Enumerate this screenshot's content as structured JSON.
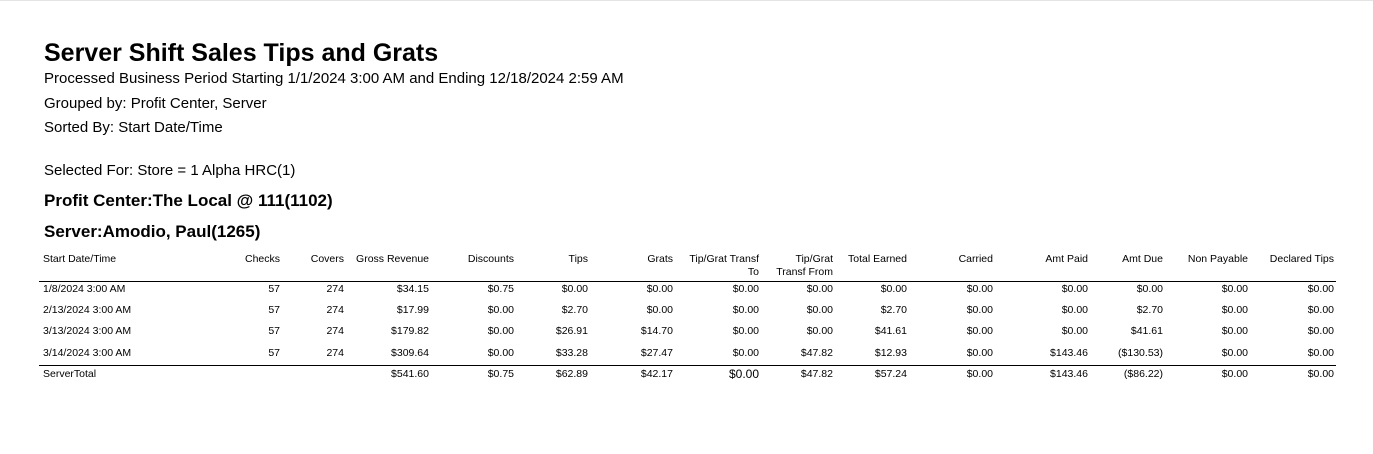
{
  "report": {
    "title": "Server Shift Sales Tips and Grats",
    "period": "Processed Business Period Starting 1/1/2024 3:00 AM and Ending 12/18/2024 2:59 AM",
    "grouped_by": "Grouped by: Profit Center, Server",
    "sorted_by": "Sorted By: Start Date/Time",
    "selected_for": "Selected For:  Store = 1 Alpha HRC(1)",
    "profit_center": "Profit Center:The Local @ 111(1102)",
    "server": "Server:Amodio, Paul(1265)"
  },
  "table": {
    "headers": [
      "Start Date/Time",
      "Checks",
      "Covers",
      "Gross Revenue",
      "Discounts",
      "Tips",
      "Grats",
      "Tip/Grat Transf\nTo",
      "Tip/Grat\nTransf From",
      "Total Earned",
      "Carried",
      "Amt Paid",
      "Amt Due",
      "Non Payable",
      "Declared Tips"
    ],
    "rows": [
      [
        "1/8/2024 3:00 AM",
        "57",
        "274",
        "$34.15",
        "$0.75",
        "$0.00",
        "$0.00",
        "$0.00",
        "$0.00",
        "$0.00",
        "$0.00",
        "$0.00",
        "$0.00",
        "$0.00",
        "$0.00"
      ],
      [
        "2/13/2024 3:00 AM",
        "57",
        "274",
        "$17.99",
        "$0.00",
        "$2.70",
        "$0.00",
        "$0.00",
        "$0.00",
        "$2.70",
        "$0.00",
        "$0.00",
        "$2.70",
        "$0.00",
        "$0.00"
      ],
      [
        "3/13/2024 3:00 AM",
        "57",
        "274",
        "$179.82",
        "$0.00",
        "$26.91",
        "$14.70",
        "$0.00",
        "$0.00",
        "$41.61",
        "$0.00",
        "$0.00",
        "$41.61",
        "$0.00",
        "$0.00"
      ],
      [
        "3/14/2024 3:00 AM",
        "57",
        "274",
        "$309.64",
        "$0.00",
        "$33.28",
        "$27.47",
        "$0.00",
        "$47.82",
        "$12.93",
        "$0.00",
        "$143.46",
        "($130.53)",
        "$0.00",
        "$0.00"
      ]
    ],
    "total": [
      "ServerTotal",
      "",
      "",
      "$541.60",
      "$0.75",
      "$62.89",
      "$42.17",
      "$0.00",
      "$47.82",
      "$57.24",
      "$0.00",
      "$143.46",
      "($86.22)",
      "$0.00",
      "$0.00"
    ]
  }
}
